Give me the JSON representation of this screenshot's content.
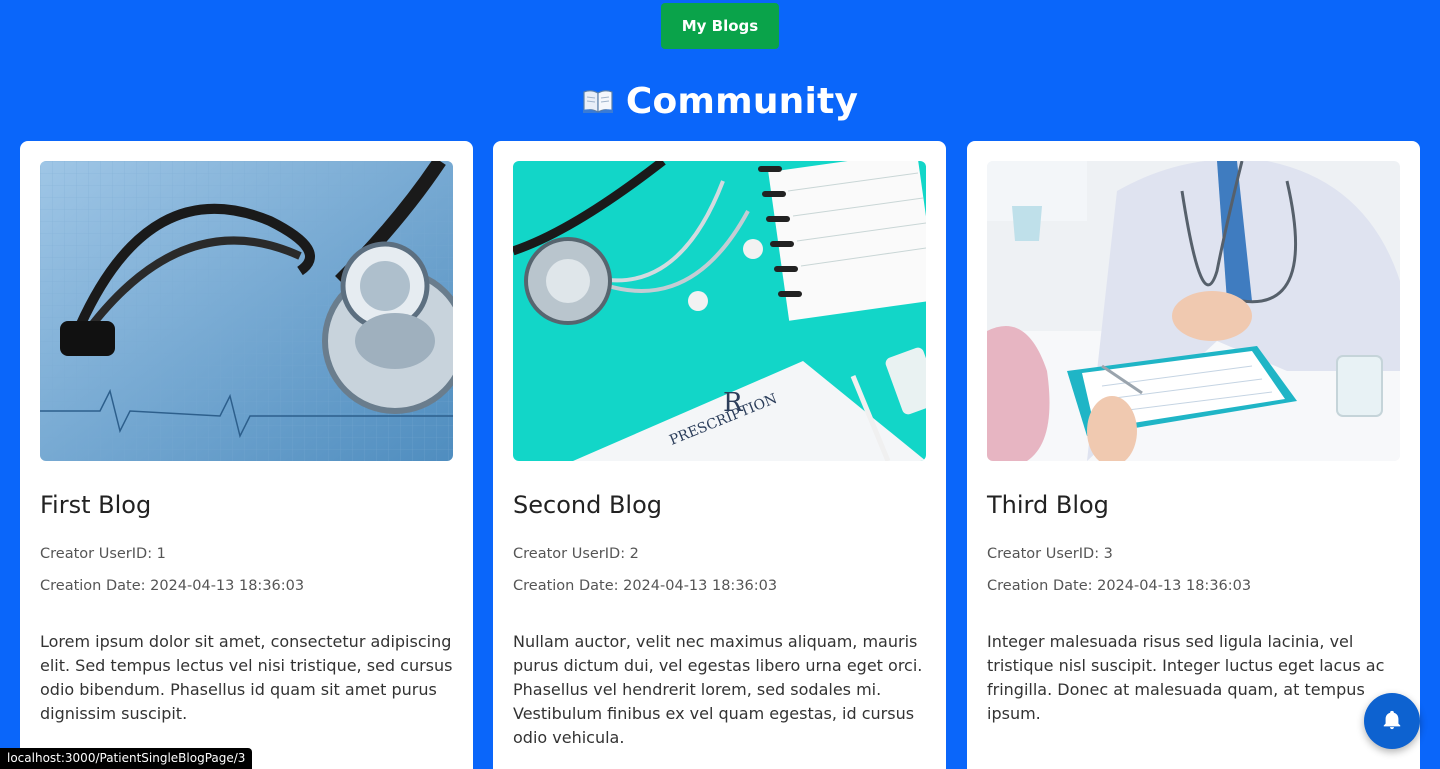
{
  "header": {
    "my_blogs_label": "My Blogs",
    "page_title": "Community",
    "title_icon": "open-book-icon"
  },
  "blogs": [
    {
      "title": "First Blog",
      "creator": "Creator UserID: 1",
      "date": "Creation Date: 2024-04-13 18:36:03",
      "description": "Lorem ipsum dolor sit amet, consectetur adipiscing elit. Sed tempus lectus vel nisi tristique, sed cursus odio bibendum. Phasellus id quam sit amet purus dignissim suscipit.",
      "image": "stethoscope-on-ecg-photo"
    },
    {
      "title": "Second Blog",
      "creator": "Creator UserID: 2",
      "date": "Creation Date: 2024-04-13 18:36:03",
      "description": "Nullam auctor, velit nec maximus aliquam, mauris purus dictum dui, vel egestas libero urna eget orci. Phasellus vel hendrerit lorem, sed sodales mi. Vestibulum finibus ex vel quam egestas, id cursus odio vehicula.",
      "image": "stethoscope-notebook-prescription-photo"
    },
    {
      "title": "Third Blog",
      "creator": "Creator UserID: 3",
      "date": "Creation Date: 2024-04-13 18:36:03",
      "description": "Integer malesuada risus sed ligula lacinia, vel tristique nisl suscipit. Integer luctus eget lacus ac fringilla. Donec at malesuada quam, at tempus ipsum.",
      "image": "doctor-consultation-photo"
    }
  ],
  "status_bar": {
    "url": "localhost:3000/PatientSingleBlogPage/3"
  },
  "notification": {
    "icon": "bell-icon"
  },
  "colors": {
    "background": "#0a66fa",
    "my_blogs_button": "#0aa34a",
    "bell_button": "#0d62d0"
  }
}
